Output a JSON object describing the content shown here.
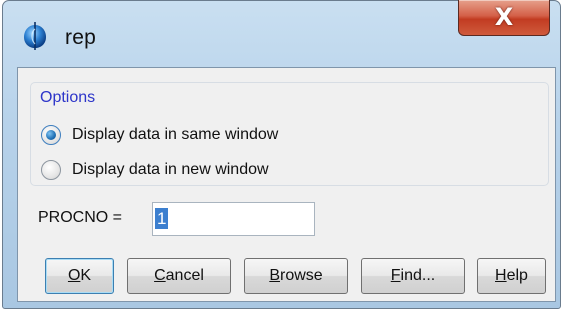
{
  "window": {
    "title": "rep",
    "close_glyph": "X",
    "app_icon": "bruker-spectrometer-icon"
  },
  "options": {
    "title": "Options",
    "radio_same": {
      "label": "Display data in same window",
      "checked": true
    },
    "radio_new": {
      "label": "Display data in new window",
      "checked": false
    }
  },
  "procno": {
    "label": "PROCNO =",
    "value": "1"
  },
  "buttons": {
    "ok": {
      "mnemonic": "O",
      "rest": "K"
    },
    "cancel": {
      "mnemonic": "C",
      "rest": "ancel"
    },
    "browse": {
      "mnemonic": "B",
      "rest": "rowse"
    },
    "find": {
      "mnemonic": "F",
      "rest": "ind..."
    },
    "help": {
      "mnemonic": "H",
      "rest": "elp"
    }
  },
  "colors": {
    "frame": "#b7d2ea",
    "client_bg": "#f0f0f0",
    "group_title": "#2d35c9",
    "close_red": "#c23c22",
    "selection": "#3c7fcf"
  }
}
